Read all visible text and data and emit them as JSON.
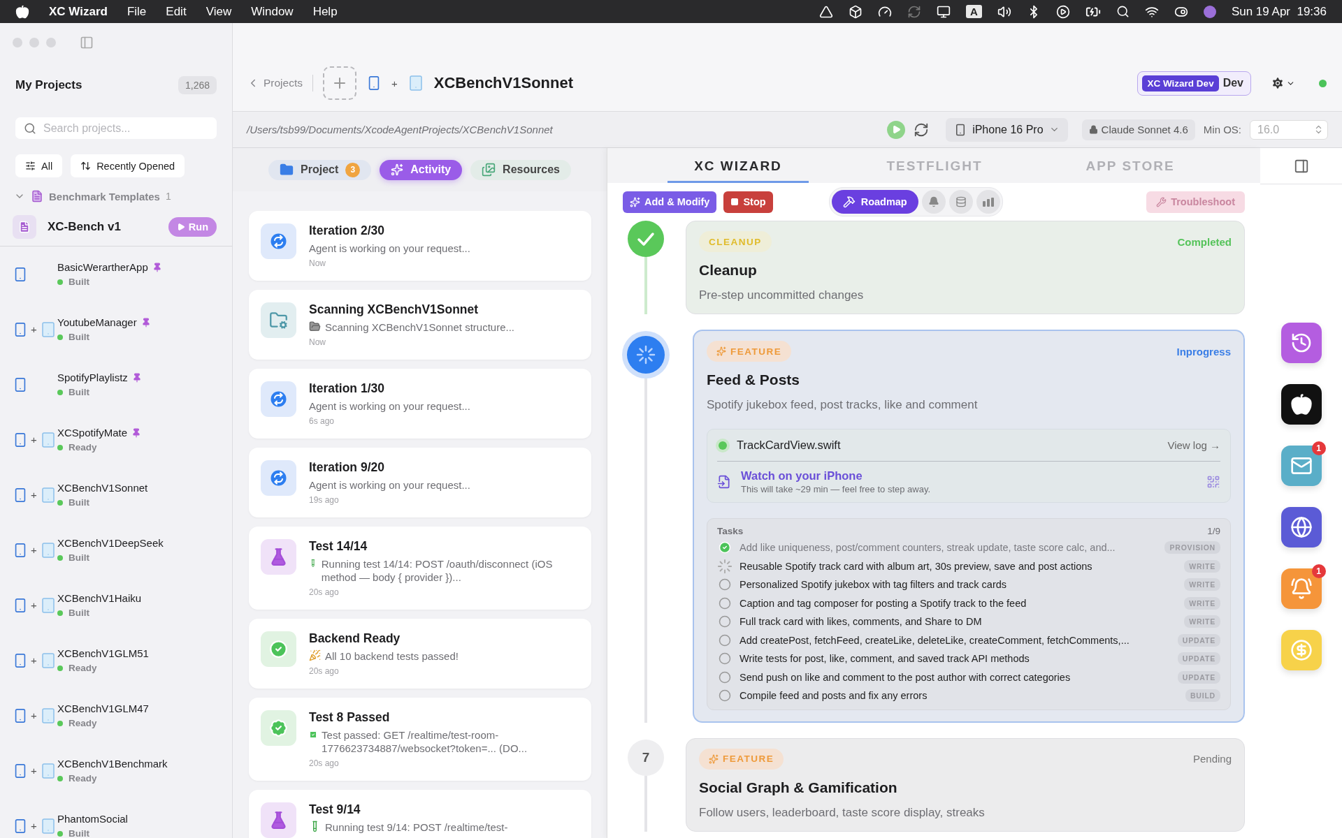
{
  "menubar": {
    "app": "XC Wizard",
    "menus": [
      "File",
      "Edit",
      "View",
      "Window",
      "Help"
    ],
    "input_source": "A",
    "clock": "Sun 19 Apr  19:36"
  },
  "sidebar": {
    "title": "My Projects",
    "count": "1,268",
    "search": {
      "placeholder": "Search projects..."
    },
    "filters": [
      {
        "label": "All",
        "kind": "sliders"
      },
      {
        "label": "Recently Opened",
        "kind": "sort"
      }
    ],
    "group": {
      "label": "Benchmark Templates",
      "count": "1",
      "expanded": true,
      "template": {
        "name": "XC-Bench v1",
        "action": "Run"
      }
    },
    "projects": [
      {
        "name": "BasicWerartherApp",
        "status": "Built",
        "pinned": true,
        "kind": "phone"
      },
      {
        "name": "YoutubeManager",
        "status": "Built",
        "pinned": true,
        "kind": "pair",
        "joiner": "+"
      },
      {
        "name": "SpotifyPlaylistz",
        "status": "Built",
        "pinned": true,
        "kind": "phone"
      },
      {
        "name": "XCSpotifyMate",
        "status": "Ready",
        "pinned": true,
        "kind": "pair",
        "joiner": "+"
      },
      {
        "name": "XCBenchV1Sonnet",
        "status": "Built",
        "pinned": false,
        "kind": "pair",
        "joiner": "+"
      },
      {
        "name": "XCBenchV1DeepSeek",
        "status": "Built",
        "pinned": false,
        "kind": "pair",
        "joiner": "+"
      },
      {
        "name": "XCBenchV1Haiku",
        "status": "Built",
        "pinned": false,
        "kind": "pair",
        "joiner": "+"
      },
      {
        "name": "XCBenchV1GLM51",
        "status": "Ready",
        "pinned": false,
        "kind": "pair",
        "joiner": "+"
      },
      {
        "name": "XCBenchV1GLM47",
        "status": "Ready",
        "pinned": false,
        "kind": "pair",
        "joiner": "+"
      },
      {
        "name": "XCBenchV1Benchmark",
        "status": "Ready",
        "pinned": false,
        "kind": "pair",
        "joiner": "+"
      },
      {
        "name": "PhantomSocial",
        "status": "Built",
        "pinned": false,
        "kind": "pair",
        "joiner": "+"
      }
    ]
  },
  "header": {
    "back": "Projects",
    "joiner": "+",
    "title": "XCBenchV1Sonnet",
    "env_tag": "XC Wizard Dev",
    "env": "Dev",
    "online": true
  },
  "pathbar": {
    "path": "/Users/tsb99/Documents/XcodeAgentProjects/XCBenchV1Sonnet",
    "device": "iPhone 16 Pro",
    "model": "Claude Sonnet 4.6",
    "min_os": {
      "label": "Min OS:",
      "value": "16.0",
      "disabled": true
    }
  },
  "activity_tabs": [
    {
      "label": "Project",
      "badge": "3",
      "selected": false,
      "kind": "project"
    },
    {
      "label": "Activity",
      "selected": true,
      "kind": "activity"
    },
    {
      "label": "Resources",
      "selected": false,
      "kind": "resources"
    }
  ],
  "activity": [
    {
      "kind": "iteration",
      "title": "Iteration 2/30",
      "message": "Agent is working on your request...",
      "time": "Now"
    },
    {
      "kind": "scan",
      "title": "Scanning XCBenchV1Sonnet",
      "message": "Scanning XCBenchV1Sonnet structure...",
      "time": "Now"
    },
    {
      "kind": "iteration",
      "title": "Iteration 1/30",
      "message": "Agent is working on your request...",
      "time": "6s ago"
    },
    {
      "kind": "iteration",
      "title": "Iteration 9/20",
      "message": "Agent is working on your request...",
      "time": "19s ago"
    },
    {
      "kind": "test",
      "title": "Test 14/14",
      "message": "Running test 14/14: POST /oauth/disconnect (iOS method — body { provider })...",
      "time": "20s ago"
    },
    {
      "kind": "success",
      "title": "Backend Ready",
      "message": "All 10 backend tests passed!",
      "time": "20s ago"
    },
    {
      "kind": "passed",
      "title": "Test 8 Passed",
      "message": "Test passed: GET /realtime/test-room-1776623734887/websocket?token=... (DO...",
      "time": "20s ago"
    },
    {
      "kind": "test",
      "title": "Test 9/14",
      "message": "Running test 9/14: POST /realtime/test-"
    }
  ],
  "wizard_tabs": [
    {
      "label": "XC WIZARD",
      "selected": true
    },
    {
      "label": "TESTFLIGHT",
      "selected": false
    },
    {
      "label": "APP STORE",
      "selected": false
    }
  ],
  "toolbar": {
    "add": "Add & Modify",
    "stop": "Stop",
    "views": [
      {
        "kind": "roadmap",
        "label": "Roadmap",
        "selected": true
      },
      {
        "kind": "bell",
        "selected": false
      },
      {
        "kind": "database",
        "selected": false
      },
      {
        "kind": "chart",
        "selected": false
      }
    ],
    "troubleshoot": {
      "label": "Troubleshoot",
      "disabled": true
    }
  },
  "steps": [
    {
      "kind": "completed",
      "tag": "CLEANUP",
      "title": "Cleanup",
      "description": "Pre-step uncommitted changes",
      "status_label": "Completed"
    },
    {
      "kind": "inprogress",
      "tag": "FEATURE",
      "title": "Feed & Posts",
      "description": "Spotify jukebox feed, post tracks, like and comment",
      "status_label": "Inprogress",
      "file": {
        "name": "TrackCardView.swift",
        "link": "View log →"
      },
      "watch": {
        "title": "Watch on your iPhone",
        "subtitle": "This will take ~29 min — feel free to step away."
      },
      "tasks": {
        "label": "Tasks",
        "count": "1/9",
        "items": [
          {
            "text": "Add like uniqueness, post/comment counters, streak update, taste score calc, and...",
            "tag": "PROVISION",
            "kind": "done"
          },
          {
            "text": "Reusable Spotify track card with album art, 30s preview, save and post actions",
            "tag": "WRITE",
            "kind": "running"
          },
          {
            "text": "Personalized Spotify jukebox with tag filters and track cards",
            "tag": "WRITE",
            "kind": "pending"
          },
          {
            "text": "Caption and tag composer for posting a Spotify track to the feed",
            "tag": "WRITE",
            "kind": "pending"
          },
          {
            "text": "Full track card with likes, comments, and Share to DM",
            "tag": "WRITE",
            "kind": "pending"
          },
          {
            "text": "Add createPost, fetchFeed, createLike, deleteLike, createComment, fetchComments,...",
            "tag": "UPDATE",
            "kind": "pending"
          },
          {
            "text": "Write tests for post, like, comment, and saved track API methods",
            "tag": "UPDATE",
            "kind": "pending"
          },
          {
            "text": "Send push on like and comment to the post author with correct categories",
            "tag": "UPDATE",
            "kind": "pending"
          },
          {
            "text": "Compile feed and posts and fix any errors",
            "tag": "BUILD",
            "kind": "pending"
          }
        ]
      }
    },
    {
      "kind": "pending",
      "number": "7",
      "tag": "FEATURE",
      "title": "Social Graph & Gamification",
      "description": "Follow users, leaderboard, taste score display, streaks",
      "status_label": "Pending"
    }
  ],
  "dock": [
    {
      "kind": "history",
      "color": "#b45de0"
    },
    {
      "kind": "apple",
      "color": "#111111"
    },
    {
      "kind": "mail",
      "color": "#5aaec8",
      "badge": "1"
    },
    {
      "kind": "globe",
      "color": "#5b5bd6"
    },
    {
      "kind": "bell",
      "color": "#f5953a",
      "badge": "1"
    },
    {
      "kind": "dollar",
      "color": "#f7d24a"
    }
  ]
}
